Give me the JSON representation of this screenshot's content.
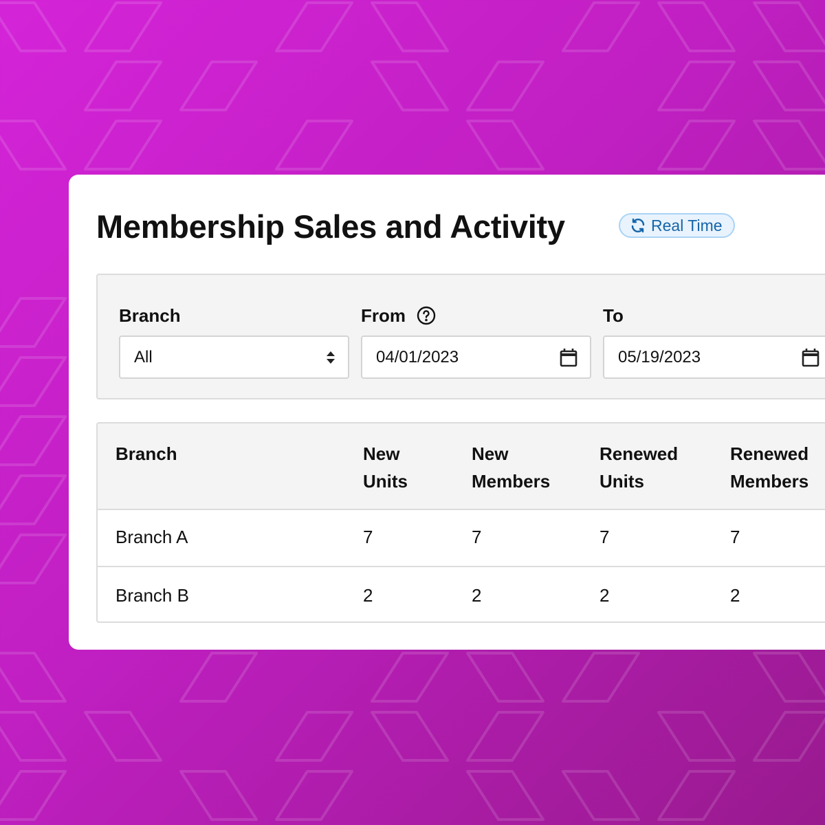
{
  "colors": {
    "background_start": "#d424d8",
    "background_end": "#981a8e",
    "badge_text": "#1565a8",
    "badge_bg": "#e8f3fd"
  },
  "header": {
    "title": "Membership Sales and Activity",
    "badge": {
      "label": "Real Time",
      "icon": "refresh-icon"
    }
  },
  "filters": {
    "branch": {
      "label": "Branch",
      "value": "All",
      "icon": "sort-arrows-icon"
    },
    "from": {
      "label": "From",
      "value": "04/01/2023",
      "help_icon": "help-circle-icon",
      "icon": "calendar-icon"
    },
    "to": {
      "label": "To",
      "value": "05/19/2023",
      "icon": "calendar-icon"
    }
  },
  "table": {
    "columns": [
      {
        "line1": "Branch",
        "line2": ""
      },
      {
        "line1": "New",
        "line2": "Units"
      },
      {
        "line1": "New",
        "line2": "Members"
      },
      {
        "line1": "Renewed",
        "line2": "Units"
      },
      {
        "line1": "Renewed",
        "line2": "Members"
      }
    ],
    "rows": [
      [
        "Branch A",
        "7",
        "7",
        "7",
        "7"
      ],
      [
        "Branch B",
        "2",
        "2",
        "2",
        "2"
      ]
    ]
  }
}
